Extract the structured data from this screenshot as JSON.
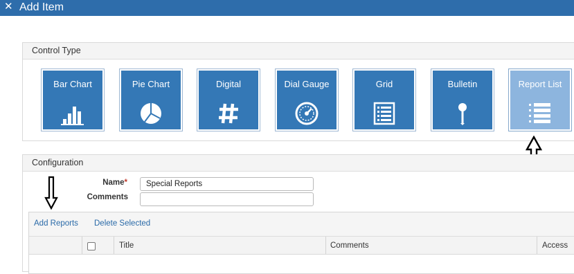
{
  "window": {
    "title": "Add Item",
    "close_glyph": "✕"
  },
  "control_type": {
    "heading": "Control Type",
    "selected": "Report List",
    "tiles": [
      {
        "label": "Bar Chart",
        "icon": "bar-chart-icon"
      },
      {
        "label": "Pie Chart",
        "icon": "pie-chart-icon"
      },
      {
        "label": "Digital",
        "icon": "hash-icon"
      },
      {
        "label": "Dial Gauge",
        "icon": "gauge-icon"
      },
      {
        "label": "Grid",
        "icon": "grid-list-icon"
      },
      {
        "label": "Bulletin",
        "icon": "pin-icon"
      },
      {
        "label": "Report List",
        "icon": "numbered-list-icon"
      }
    ]
  },
  "configuration": {
    "heading": "Configuration",
    "name_label": "Name",
    "name_required_marker": "*",
    "name_value": "Special Reports",
    "comments_label": "Comments",
    "comments_value": "",
    "toolbar": {
      "add_label": "Add Reports",
      "delete_label": "Delete Selected"
    },
    "columns": [
      "Title",
      "Comments",
      "Access"
    ]
  },
  "colors": {
    "title_bar": "#2e6dab",
    "tile": "#3478b6",
    "tile_selected": "#8db5de",
    "link": "#2a6aa8"
  }
}
